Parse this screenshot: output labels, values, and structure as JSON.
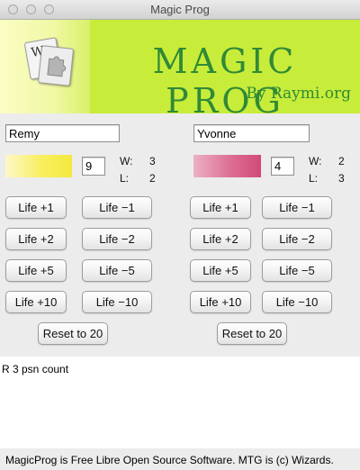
{
  "window": {
    "title": "Magic Prog"
  },
  "banner": {
    "title": "MAGIC PROG",
    "subtitle": "By Raymi.org"
  },
  "players": [
    {
      "name": "Remy",
      "color": "#f8ef5e",
      "count": "9",
      "wins_label": "W:",
      "wins": "3",
      "losses_label": "L:",
      "losses": "2",
      "buttons": {
        "plus1": "Life +1",
        "minus1": "Life −1",
        "plus2": "Life +2",
        "minus2": "Life −2",
        "plus5": "Life +5",
        "minus5": "Life −5",
        "plus10": "Life +10",
        "minus10": "Life −10",
        "reset": "Reset to 20"
      }
    },
    {
      "name": "Yvonne",
      "color": "#d8507e",
      "count": "4",
      "wins_label": "W:",
      "wins": "2",
      "losses_label": "L:",
      "losses": "3",
      "buttons": {
        "plus1": "Life +1",
        "minus1": "Life −1",
        "plus2": "Life +2",
        "minus2": "Life −2",
        "plus5": "Life +5",
        "minus5": "Life −5",
        "plus10": "Life +10",
        "minus10": "Life −10",
        "reset": "Reset to 20"
      }
    }
  ],
  "output": {
    "text": "R 3 psn count"
  },
  "footer": {
    "text": "MagicProg is Free Libre Open Source Software. MTG is (c) Wizards."
  },
  "colors": {
    "banner": "#c8ec3a",
    "banner_text": "#2f8a36"
  }
}
